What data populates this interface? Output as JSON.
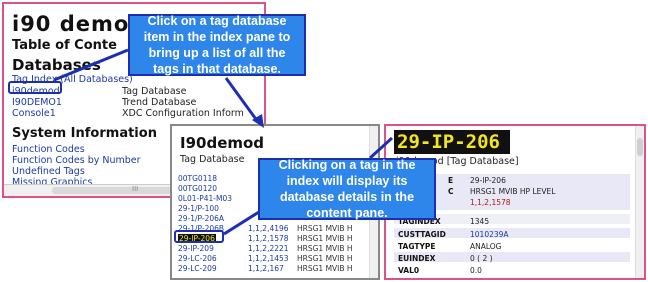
{
  "index_top": {
    "app_title": "i90 demo",
    "toc_title": "Table of Conte",
    "databases_heading": "Databases",
    "tag_index_link": "Tag Index (All Databases)",
    "databases": [
      {
        "name": "i90demod",
        "desc": "Tag Database"
      },
      {
        "name": "I90DEMO1",
        "desc": "Trend Database"
      },
      {
        "name": "Console1",
        "desc": "XDC Configuration Inform"
      }
    ],
    "system_heading": "System Information",
    "system_links": [
      "Function Codes",
      "Function Codes by Number",
      "Undefined Tags",
      "Missing Graphics"
    ],
    "scroll_marker": "III"
  },
  "index_pane": {
    "title": "I90demod",
    "subtitle": "Tag Database",
    "rows": [
      {
        "tag": "00TG0118",
        "addr": "",
        "desc": ""
      },
      {
        "tag": "00TG0120",
        "addr": "",
        "desc": ""
      },
      {
        "tag": "0L01-P41-M03",
        "addr": "",
        "desc": ""
      },
      {
        "tag": "29-1/P-100",
        "addr": "",
        "desc": ""
      },
      {
        "tag": "29-1/P-206A",
        "addr": "",
        "desc": ""
      },
      {
        "tag": "29-1/P-206B",
        "addr": "1,1,2,4196",
        "desc": "HRSG1 MVIB H"
      },
      {
        "tag": "29-IP-206",
        "addr": "1,1,2,1578",
        "desc": "HRSG1 MVIB H"
      },
      {
        "tag": "29-IP-209",
        "addr": "1,1,2,2221",
        "desc": "HRSG1 MVIB H"
      },
      {
        "tag": "29-LC-206",
        "addr": "1,1,2,1453",
        "desc": "HRSG1 MVIB H"
      },
      {
        "tag": "29-LC-209",
        "addr": "1,1,2,167",
        "desc": "HRSG1 MVIB H"
      }
    ]
  },
  "content_pane": {
    "tag_title": "29-IP-206",
    "db_subtitle": "i90demod [Tag Database]",
    "fields_top": [
      {
        "name": "E",
        "value": "29-IP-206",
        "style": ""
      },
      {
        "name": "C",
        "value": "HRSG1 MVIB HP    LEVEL",
        "style": ""
      },
      {
        "name": "",
        "value": "1,1,2,1578",
        "style": "red"
      }
    ],
    "fields_bottom": [
      {
        "name": "TAGINDEX",
        "value": "1345",
        "style": ""
      },
      {
        "name": "CUSTTAGID",
        "value": "1010239A",
        "style": "blue"
      },
      {
        "name": "TAGTYPE",
        "value": "ANALOG",
        "style": ""
      },
      {
        "name": "EUINDEX",
        "value": "0   ( 2 )",
        "style": ""
      },
      {
        "name": "VAL0",
        "value": "0.0",
        "style": ""
      }
    ]
  },
  "callouts": {
    "top": "Click on a tag database item in the index pane to bring up a list of all the tags in that database.",
    "bottom": "Clicking on a tag in the index will display its database details in the content pane."
  },
  "colors": {
    "callout_fill": "#2f86ea",
    "callout_border": "#1c2fb0",
    "frame_pink": "#e0508a",
    "tag_title_bg": "#111111",
    "tag_title_fg": "#f4e61c"
  }
}
